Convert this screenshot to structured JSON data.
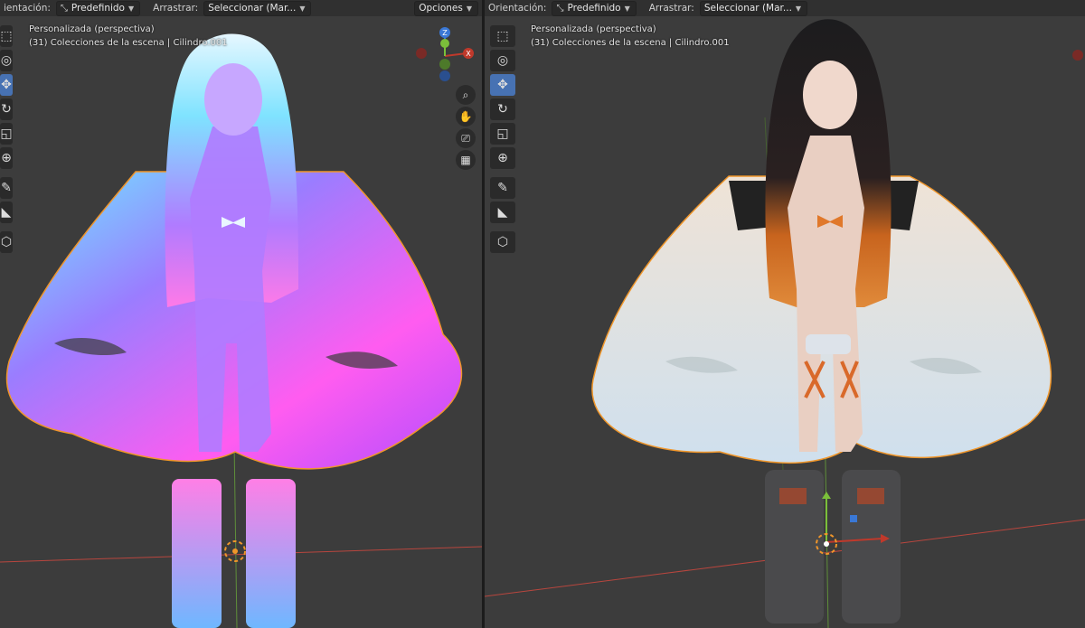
{
  "left_viewport": {
    "header": {
      "orientation_label": "ientación:",
      "orientation_value": "Predefinido",
      "drag_label": "Arrastrar:",
      "drag_value": "Seleccionar (Mar...",
      "options_label": "Opciones"
    },
    "view_name": "Personalizada (perspectiva)",
    "collection_info": "(31) Colecciones de la escena | Cilindro.001",
    "gizmo": {
      "z_label": "Z",
      "x_label": "X",
      "y_label": "Y"
    },
    "shading": "normal-map-colored"
  },
  "right_viewport": {
    "header": {
      "orientation_label": "Orientación:",
      "orientation_value": "Predefinido",
      "drag_label": "Arrastrar:",
      "drag_value": "Seleccionar (Mar..."
    },
    "view_name": "Personalizada (perspectiva)",
    "collection_info": "(31) Colecciones de la escena | Cilindro.001",
    "shading": "material-preview"
  },
  "tools": [
    "cursor-select-icon",
    "3d-cursor-icon",
    "move-icon",
    "rotate-icon",
    "scale-icon",
    "transform-icon",
    "annotate-icon",
    "measure-icon",
    "add-cube-icon"
  ],
  "colors": {
    "axis_x": "#c0392b",
    "axis_y": "#7bbf3a",
    "axis_z": "#3a78d6",
    "selection": "#f0962a",
    "active_tool": "#4772b3"
  }
}
